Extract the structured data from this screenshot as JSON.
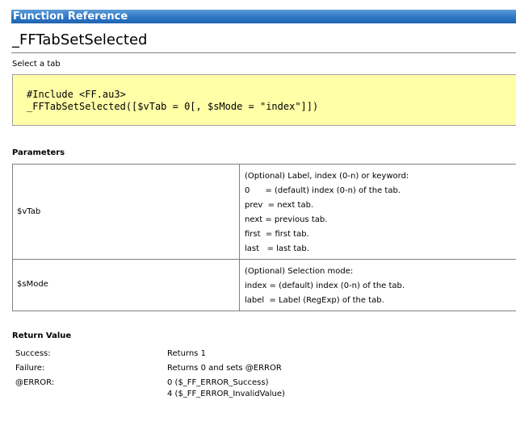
{
  "header": {
    "title": "Function Reference"
  },
  "page": {
    "title": "_FFTabSetSelected",
    "summary": "Select a tab"
  },
  "syntax": {
    "lines": [
      "#Include <FF.au3>",
      "_FFTabSetSelected([$vTab = 0[, $sMode = \"index\"]])"
    ]
  },
  "parameters": {
    "heading": "Parameters",
    "rows": [
      {
        "name": "$vTab",
        "description": [
          "(Optional) Label, index (0-n) or keyword:",
          "0      = (default) index (0-n) of the tab.",
          "prev  = next tab.",
          "next = previous tab.",
          "first  = first tab.",
          "last   = last tab."
        ]
      },
      {
        "name": "$sMode",
        "description": [
          "(Optional) Selection mode:",
          "index = (default) index (0-n) of the tab.",
          "label  = Label (RegExp) of the tab."
        ]
      }
    ]
  },
  "return_value": {
    "heading": "Return Value",
    "rows": [
      {
        "label": "Success:",
        "value": [
          "Returns 1"
        ]
      },
      {
        "label": "Failure:",
        "value": [
          "Returns 0 and sets @ERROR"
        ]
      },
      {
        "label": "@ERROR:",
        "value": [
          "0 ($_FF_ERROR_Success)",
          "4 ($_FF_ERROR_InvalidValue)"
        ]
      }
    ]
  },
  "colors": {
    "header_bar": "#2f77c5",
    "code_background": "#ffffa8",
    "table_border": "#808080"
  }
}
